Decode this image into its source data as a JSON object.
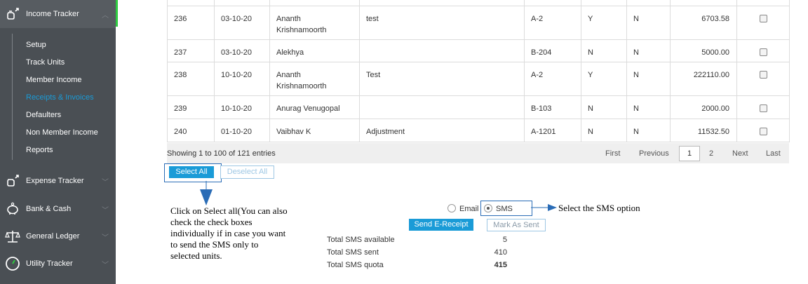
{
  "sidebar": {
    "income": {
      "label": "Income Tracker",
      "icon": "money-bag-icon"
    },
    "submenu": [
      "Setup",
      "Track Units",
      "Member Income",
      "Receipts & Invoices",
      "Defaulters",
      "Non Member Income",
      "Reports"
    ],
    "selected_submenu": "Receipts & Invoices",
    "items": [
      {
        "label": "Expense Tracker",
        "icon": "money-bag-out-icon"
      },
      {
        "label": "Bank & Cash",
        "icon": "piggy-bank-icon"
      },
      {
        "label": "General Ledger",
        "icon": "scales-icon"
      },
      {
        "label": "Utility Tracker",
        "icon": "gauge-icon"
      }
    ],
    "accent_color": "#2ecc40",
    "selected_color": "#1a9bd7"
  },
  "table": {
    "rows": [
      {
        "no": "236",
        "date": "03-10-20",
        "name": "Ananth Krishnamoorth",
        "note": "test",
        "unit": "A-2",
        "f1": "Y",
        "f2": "N",
        "amount": "6703.58"
      },
      {
        "no": "237",
        "date": "03-10-20",
        "name": "Alekhya",
        "note": "",
        "unit": "B-204",
        "f1": "N",
        "f2": "N",
        "amount": "5000.00"
      },
      {
        "no": "238",
        "date": "10-10-20",
        "name": "Ananth Krishnamoorth",
        "note": "Test",
        "unit": "A-2",
        "f1": "Y",
        "f2": "N",
        "amount": "222110.00"
      },
      {
        "no": "239",
        "date": "10-10-20",
        "name": "Anurag Venugopal",
        "note": "",
        "unit": "B-103",
        "f1": "N",
        "f2": "N",
        "amount": "2000.00"
      },
      {
        "no": "240",
        "date": "01-10-20",
        "name": "Vaibhav K",
        "note": "Adjustment",
        "unit": "A-1201",
        "f1": "N",
        "f2": "N",
        "amount": "11532.50"
      }
    ]
  },
  "pager": {
    "info": "Showing 1 to 100 of 121 entries",
    "first": "First",
    "previous": "Previous",
    "page1": "1",
    "page2": "2",
    "next": "Next",
    "last": "Last"
  },
  "actions": {
    "select_all": "Select All",
    "deselect_all": "Deselect All",
    "email_label": "Email",
    "sms_label": "SMS",
    "send_receipt": "Send E-Receipt",
    "mark_sent": "Mark As Sent"
  },
  "stats": {
    "available_label": "Total SMS available",
    "available": "5",
    "sent_label": "Total SMS sent",
    "sent": "410",
    "quota_label": "Total SMS quota",
    "quota": "415"
  },
  "annotations": {
    "select_all_note": "Click on Select all(You can also check the check boxes individually if in case you want to send the SMS only to selected units.",
    "sms_note": "Select the SMS option"
  }
}
